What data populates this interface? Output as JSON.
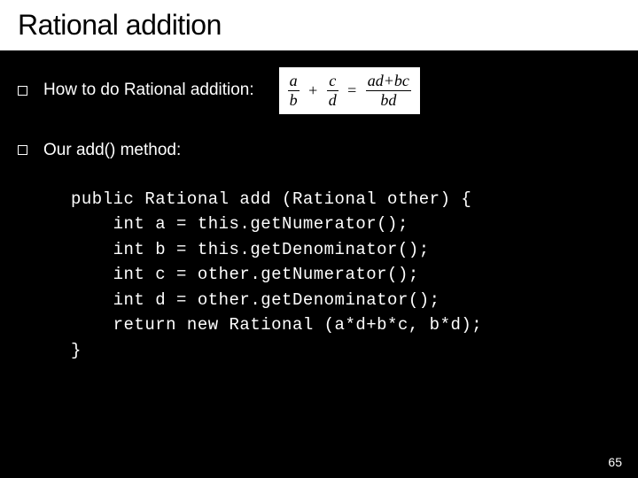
{
  "title": "Rational addition",
  "bullets": [
    {
      "text": "How to do Rational addition:"
    },
    {
      "text": "Our add() method:"
    }
  ],
  "formula": {
    "lhs_term1_num": "a",
    "lhs_term1_den": "b",
    "plus": "+",
    "lhs_term2_num": "c",
    "lhs_term2_den": "d",
    "eq": "=",
    "rhs_num": "ad+bc",
    "rhs_den": "bd"
  },
  "code": {
    "l1": "public Rational add (Rational other) {",
    "l2": "    int a = this.getNumerator();",
    "l3": "    int b = this.getDenominator();",
    "l4": "    int c = other.getNumerator();",
    "l5": "    int d = other.getDenominator();",
    "l6": "    return new Rational (a*d+b*c, b*d);",
    "l7": "}"
  },
  "page_number": "65"
}
